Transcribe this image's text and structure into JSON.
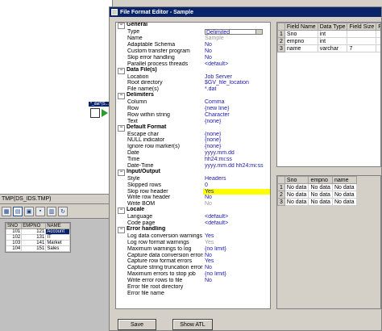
{
  "flatfile_label": "*_dat*(S...",
  "bottom_panel": {
    "title": "TMP(DS_IDS.TMP)",
    "toolbar_icons": [
      "grid-icon",
      "table-view-icon",
      "image-icon",
      "save-icon",
      "print-icon",
      "refresh-icon"
    ],
    "columns": [
      "SNO",
      "EMPNO",
      "NAME"
    ],
    "rows": [
      [
        "101",
        "121",
        "Account"
      ],
      [
        "102",
        "131",
        "IT"
      ],
      [
        "103",
        "141",
        "Market"
      ],
      [
        "104",
        "151",
        "Sales"
      ]
    ]
  },
  "dialog": {
    "title": "File Format Editor - Sample",
    "properties": [
      {
        "type": "section",
        "name": "General"
      },
      {
        "name": "Type",
        "value": "Delimited",
        "combo": true
      },
      {
        "name": "Name",
        "value": "Sample",
        "dim": true
      },
      {
        "name": "Adaptable Schema",
        "value": "No"
      },
      {
        "name": "Custom transfer program",
        "value": "No"
      },
      {
        "name": "Skip error handling",
        "value": "No"
      },
      {
        "name": "Parallel process threads",
        "value": "<default>"
      },
      {
        "type": "section",
        "name": "Data File(s)"
      },
      {
        "name": "Location",
        "value": "Job Server"
      },
      {
        "name": "Root directory",
        "value": "$GV_file_location"
      },
      {
        "name": "File name(s)",
        "value": "*.dat"
      },
      {
        "type": "section",
        "name": "Delimiters"
      },
      {
        "name": "Column",
        "value": "Comma"
      },
      {
        "name": "Row",
        "value": "{new line}"
      },
      {
        "name": "Row within string",
        "value": "Character"
      },
      {
        "name": "Text",
        "value": "{none}"
      },
      {
        "type": "section",
        "name": "Default Format"
      },
      {
        "name": "Escape char",
        "value": "{none}"
      },
      {
        "name": "NULL indicator",
        "value": "{none}"
      },
      {
        "name": "Ignore row marker(s)",
        "value": "{none}"
      },
      {
        "name": "Date",
        "value": "yyyy.mm.dd"
      },
      {
        "name": "Time",
        "value": "hh24:mi:ss"
      },
      {
        "name": "Date-Time",
        "value": "yyyy.mm.dd hh24:mi:ss"
      },
      {
        "type": "section",
        "name": "Input/Output"
      },
      {
        "name": "Style",
        "value": "Headers"
      },
      {
        "name": "Skipped rows",
        "value": "0"
      },
      {
        "name": "Skip row header",
        "value": "Yes",
        "highlight": true
      },
      {
        "name": "Write row header",
        "value": "No"
      },
      {
        "name": "Write BOM",
        "value": "No",
        "dim": true
      },
      {
        "type": "section",
        "name": "Locale"
      },
      {
        "name": "Language",
        "value": "<default>"
      },
      {
        "name": "Code page",
        "value": "<default>"
      },
      {
        "type": "section",
        "name": "Error handling"
      },
      {
        "name": "Log data conversion warnings",
        "value": "Yes"
      },
      {
        "name": "Log row format warnings",
        "value": "Yes",
        "dim": true
      },
      {
        "name": "Maximum warnings to log",
        "value": "{no limit}"
      },
      {
        "name": "Capture data conversion errors",
        "value": "No"
      },
      {
        "name": "Capture row format errors",
        "value": "Yes"
      },
      {
        "name": "Capture string truncation errors",
        "value": "No"
      },
      {
        "name": "Maximum errors to stop job",
        "value": "{no limit}"
      },
      {
        "name": "Write error rows to file",
        "value": "No"
      },
      {
        "name": "Error file root directory",
        "value": ""
      },
      {
        "name": "Error file name",
        "value": ""
      }
    ],
    "schema": {
      "columns": [
        "Field Name",
        "Data Type",
        "Field Size",
        "Precision"
      ],
      "rows": [
        [
          "1",
          "Sno",
          "int",
          "",
          ""
        ],
        [
          "2",
          "empno",
          "int",
          "",
          ""
        ],
        [
          "3",
          "name",
          "varchar",
          "7",
          ""
        ]
      ]
    },
    "preview": {
      "columns": [
        "",
        "Sno",
        "empno",
        "name"
      ],
      "rows": [
        [
          "1",
          "No data",
          "No data",
          "No data"
        ],
        [
          "2",
          "No data",
          "No data",
          "No data"
        ],
        [
          "3",
          "No data",
          "No data",
          "No data"
        ]
      ]
    },
    "buttons": {
      "save": "Save",
      "show_atl": "Show ATL"
    }
  }
}
